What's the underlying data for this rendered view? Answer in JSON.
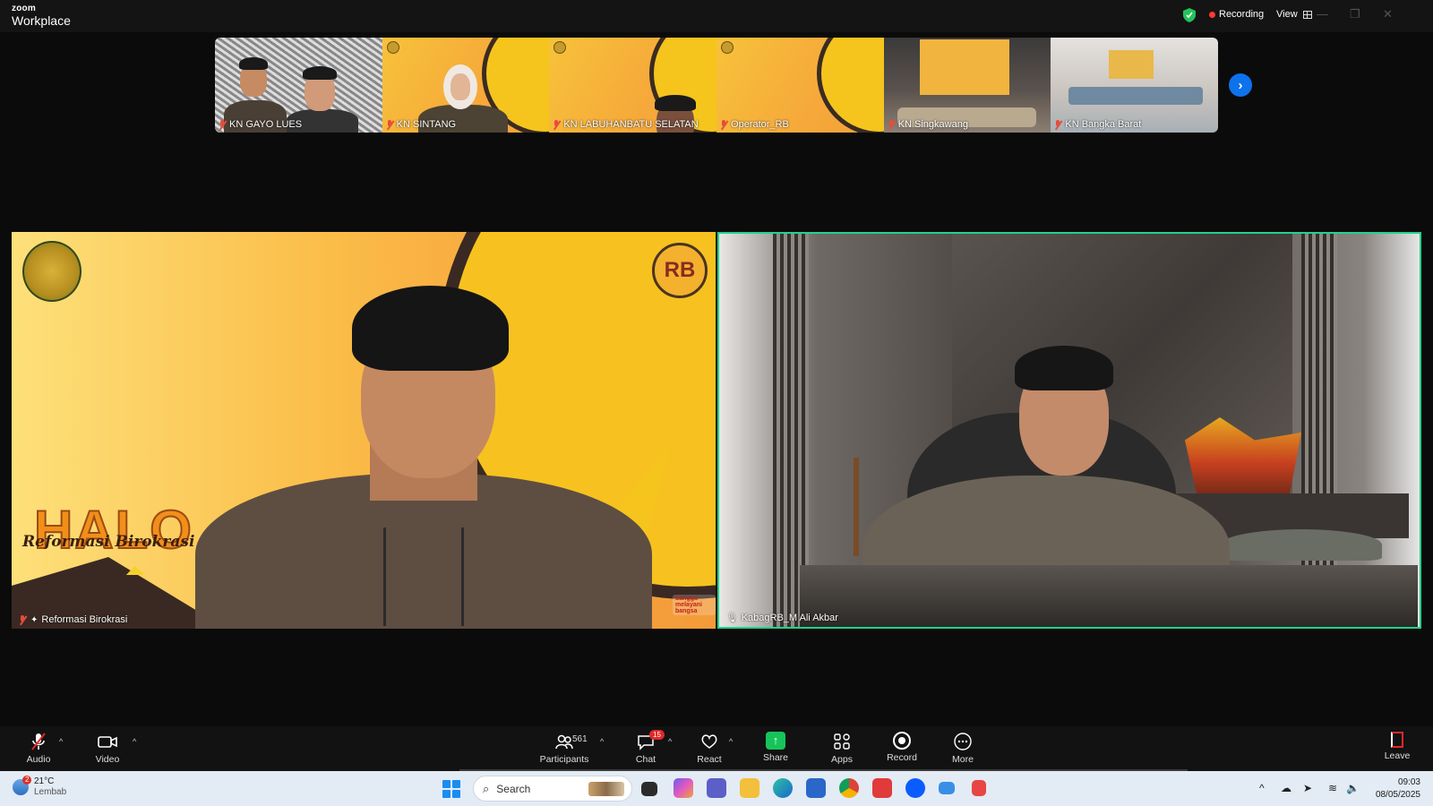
{
  "titlebar": {
    "brand_small": "zoom",
    "brand_large": "Workplace",
    "recording_label": "Recording",
    "view_label": "View",
    "window_controls": [
      "—",
      "❐",
      "✕"
    ]
  },
  "thumbnails": [
    {
      "name": "KN GAYO LUES"
    },
    {
      "name": "KN SINTANG"
    },
    {
      "name": "KN LABUHANBATU SELATAN"
    },
    {
      "name": "Operator_RB"
    },
    {
      "name": "KN Singkawang"
    },
    {
      "name": "KN Bangka Barat"
    }
  ],
  "main_videos": {
    "left": {
      "name": "Reformasi Birokrasi",
      "bg_halo": "HALO",
      "bg_subtitle": "Reformasi Birokrasi",
      "rb_logo": "RB",
      "bangga": "bangga melayani bangsa"
    },
    "right": {
      "name": "KabagRB_M Ali Akbar"
    }
  },
  "toolbar": {
    "audio": "Audio",
    "video": "Video",
    "participants": "Participants",
    "participants_count": "561",
    "chat": "Chat",
    "chat_badge": "15",
    "react": "React",
    "share": "Share",
    "apps": "Apps",
    "record": "Record",
    "more": "More",
    "leave": "Leave"
  },
  "taskbar": {
    "weather_badge": "2",
    "temperature": "21°C",
    "condition": "Lembab",
    "search_placeholder": "Search",
    "time": "09:03",
    "date": "08/05/2025"
  },
  "colors": {
    "accent_blue": "#0e72ed",
    "active_speaker": "#23d18b",
    "share_green": "#16c55a",
    "record_red": "#ff3b30"
  }
}
